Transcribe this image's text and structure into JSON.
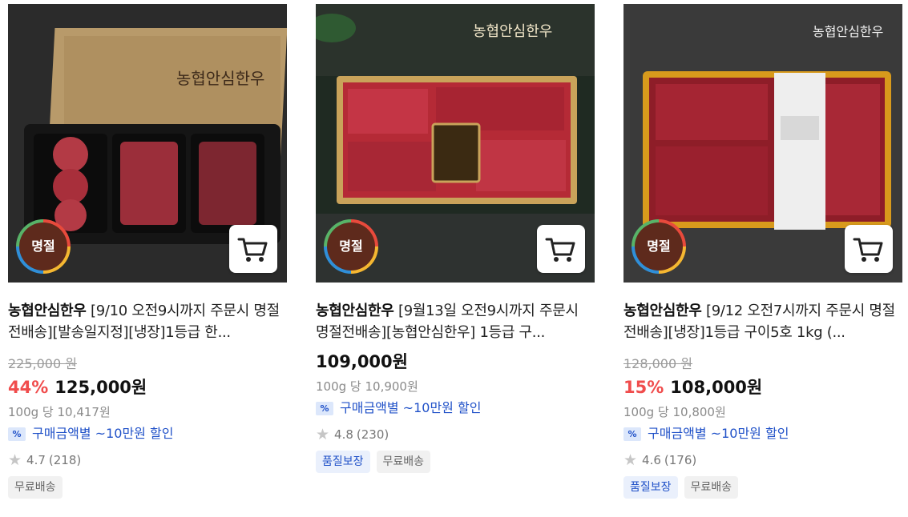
{
  "products": [
    {
      "badge": "명절",
      "brand": "농협안심한우",
      "title_rest": " [9/10 오전9시까지 주문시 명절전배송][발송일지정][냉장]1등급 한...",
      "original_price": "225,000 원",
      "discount": "44%",
      "price": "125,000원",
      "unit_price": "100g 당 10,417원",
      "coupon_icon": "%",
      "coupon": "구매금액별 ~10만원 할인",
      "rating": "4.7",
      "reviews": "(218)",
      "tags": [
        "무료배송"
      ],
      "image_logo": "농협안심한우"
    },
    {
      "badge": "명절",
      "brand": "농협안심한우",
      "title_rest": " [9월13일 오전9시까지 주문시 명절전배송][농협안심한우] 1등급 구...",
      "original_price": "",
      "discount": "",
      "price": "109,000원",
      "unit_price": "100g 당 10,900원",
      "coupon_icon": "%",
      "coupon": "구매금액별 ~10만원 할인",
      "rating": "4.8",
      "reviews": "(230)",
      "tags": [
        "품질보장",
        "무료배송"
      ],
      "image_logo": "농협안심한우"
    },
    {
      "badge": "명절",
      "brand": "농협안심한우",
      "title_rest": " [9/12 오전7시까지 주문시 명절전배송][냉장]1등급 구이5호 1kg (...",
      "original_price": "128,000 원",
      "discount": "15%",
      "price": "108,000원",
      "unit_price": "100g 당 10,800원",
      "coupon_icon": "%",
      "coupon": "구매금액별 ~10만원 할인",
      "rating": "4.6",
      "reviews": "(176)",
      "tags": [
        "품질보장",
        "무료배송"
      ],
      "image_logo": "농협안심한우"
    }
  ],
  "icons": {
    "cart": "cart-icon",
    "star": "star-icon",
    "coupon": "coupon-icon"
  },
  "colors": {
    "discount": "#f04c4c",
    "coupon": "#2051c8",
    "badge": "#5e2a1c"
  }
}
